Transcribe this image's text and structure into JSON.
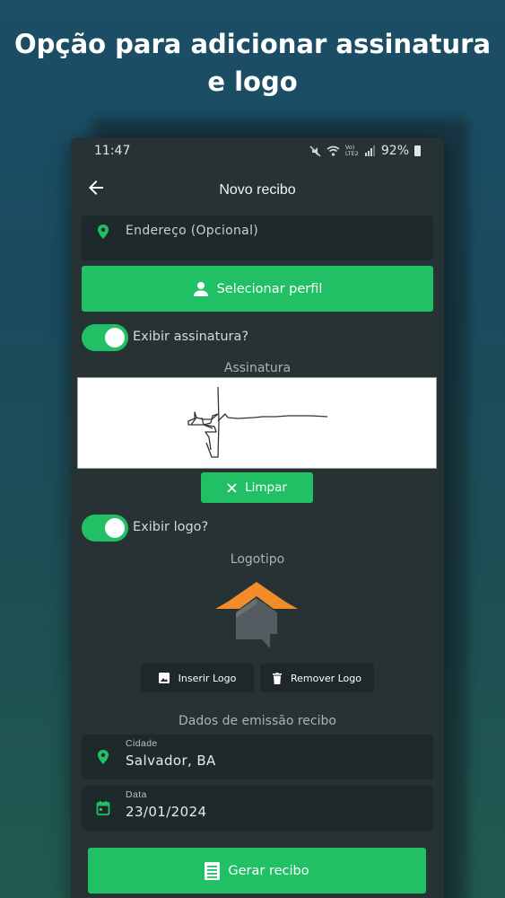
{
  "promo": {
    "title": "Opção para adicionar assinatura e logo"
  },
  "status_bar": {
    "time": "11:47",
    "network": "Vo) LTE2",
    "battery": "92%"
  },
  "appbar": {
    "title": "Novo recibo",
    "back_icon": "arrow-back-icon"
  },
  "address_field": {
    "placeholder": "Endereço (Opcional)",
    "icon": "location-pin-icon"
  },
  "select_profile_button": {
    "label": "Selecionar perfil",
    "icon": "person-icon"
  },
  "signature": {
    "toggle_label": "Exibir assinatura?",
    "toggle_on": true,
    "section_title": "Assinatura",
    "clear_label": "Limpar",
    "clear_icon": "close-icon"
  },
  "logo": {
    "toggle_label": "Exibir logo?",
    "toggle_on": true,
    "section_title": "Logotipo",
    "insert_label": "Inserir Logo",
    "insert_icon": "image-icon",
    "remove_label": "Remover Logo",
    "remove_icon": "trash-icon"
  },
  "emission": {
    "section_title": "Dados de emissão recibo",
    "city_label": "Cidade",
    "city_value": "Salvador, BA",
    "city_icon": "location-pin-icon",
    "date_label": "Data",
    "date_value": "23/01/2024",
    "date_icon": "calendar-icon"
  },
  "generate_button": {
    "label": "Gerar recibo",
    "icon": "document-icon"
  },
  "colors": {
    "accent_green": "#21c064",
    "surface": "#263234",
    "field": "#1e292b",
    "logo_orange": "#f28c28",
    "logo_gray": "#555c61"
  }
}
